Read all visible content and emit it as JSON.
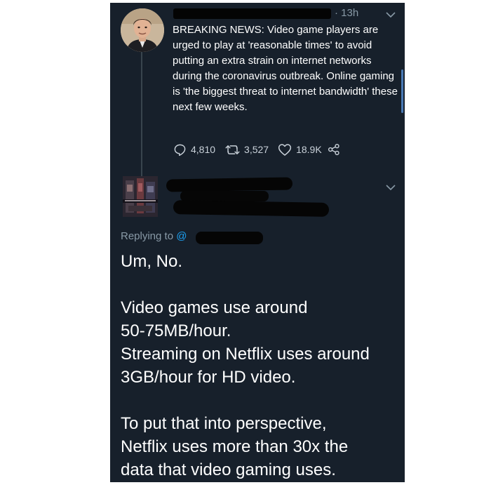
{
  "tweet": {
    "time": "· 13h",
    "text": "BREAKING NEWS: Video game players are urged to play at 'reasonable times' to avoid putting an extra strain on internet networks during the coronavirus outbreak. Online gaming is 'the biggest threat to internet bandwidth' these next few weeks.",
    "replies": "4,810",
    "retweets": "3,527",
    "likes": "18.9K"
  },
  "reply": {
    "replying_prefix": "Replying to ",
    "replying_handle": "@",
    "lines": [
      "Um, No.",
      "Video games use around",
      "50-75MB/hour.",
      "Streaming on Netflix uses around",
      "3GB/hour for HD video.",
      "To put that into perspective,",
      "Netflix uses more than 30x the",
      "data that video gaming uses."
    ]
  },
  "colors": {
    "background": "#17202b",
    "secondary_text": "#8899a6",
    "link": "#1da1f2",
    "redaction": "#050505"
  },
  "icons": {
    "reply": "reply-icon",
    "retweet": "retweet-icon",
    "like": "heart-icon",
    "share": "share-icon",
    "menu": "chevron-down-icon"
  }
}
